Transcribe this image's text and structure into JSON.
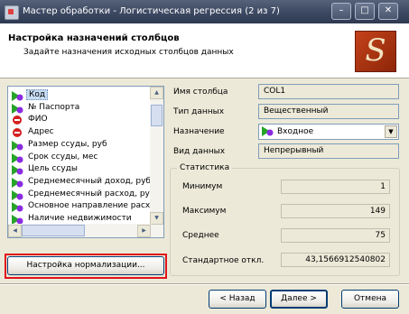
{
  "window": {
    "title": "Мастер обработки - Логистическая регрессия (2 из 7)",
    "minimize": "–",
    "maximize": "□",
    "close": "✕"
  },
  "header": {
    "title": "Настройка назначений столбцов",
    "subtitle": "Задайте назначения исходных столбцов данных",
    "logo_letter": "S"
  },
  "columns": [
    {
      "name": "Код",
      "assignment": "input",
      "selected": true
    },
    {
      "name": "№ Паспорта",
      "assignment": "input"
    },
    {
      "name": "ФИО",
      "assignment": "unused"
    },
    {
      "name": "Адрес",
      "assignment": "unused"
    },
    {
      "name": "Размер ссуды, руб",
      "assignment": "input"
    },
    {
      "name": "Срок ссуды, мес",
      "assignment": "input"
    },
    {
      "name": "Цель ссуды",
      "assignment": "input"
    },
    {
      "name": "Среднемесячный доход, руб",
      "assignment": "input"
    },
    {
      "name": "Среднемесячный расход, руб",
      "assignment": "input"
    },
    {
      "name": "Основное направление расходов",
      "assignment": "input"
    },
    {
      "name": "Наличие недвижимости",
      "assignment": "input"
    }
  ],
  "normalization_button": "Настройка нормализации...",
  "properties": {
    "name_label": "Имя столбца",
    "name_value": "COL1",
    "type_label": "Тип данных",
    "type_value": "Вещественный",
    "assignment_label": "Назначение",
    "assignment_value": "Входное",
    "kind_label": "Вид данных",
    "kind_value": "Непрерывный"
  },
  "stats": {
    "title": "Статистика",
    "min_label": "Минимум",
    "min_value": "1",
    "max_label": "Максимум",
    "max_value": "149",
    "mean_label": "Среднее",
    "mean_value": "75",
    "std_label": "Стандартное откл.",
    "std_value": "43,1566912540802"
  },
  "footer": {
    "back": "< Назад",
    "next": "Далее >",
    "cancel": "Отмена"
  },
  "colors": {
    "input_icon_green": "#28a428",
    "input_icon_purple": "#8a2be2",
    "unused_icon_red": "#d42020",
    "highlight_border": "#e0141a"
  }
}
